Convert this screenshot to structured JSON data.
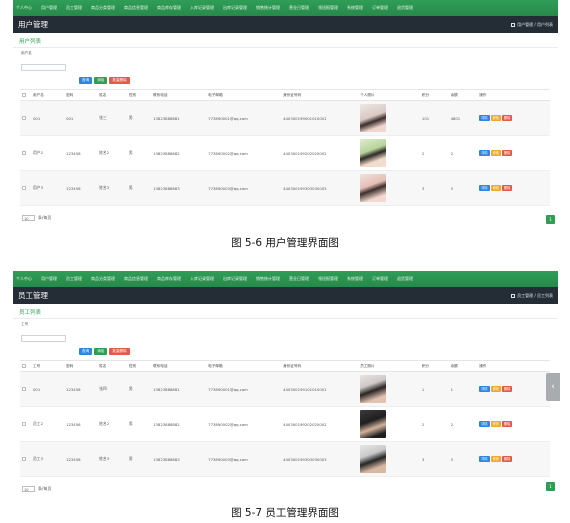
{
  "nav": [
    "个人中心",
    "用户管理",
    "员工管理",
    "商品分类管理",
    "商品信息管理",
    "商品库存管理",
    "入库记录管理",
    "出库记录管理",
    "销售统计管理",
    "营业日管理",
    "领班报管理",
    "系统管理",
    "订单管理",
    "退货管理"
  ],
  "panels": [
    {
      "page_title": "用户管理",
      "breadcrumb": "用户管理 / 用户列表",
      "section_title": "用户列表",
      "filter_label": "用户名",
      "buttons": {
        "search": "查询",
        "add": "添加",
        "batch_delete": "批量删除"
      },
      "columns": [
        "",
        "用户名",
        "密码",
        "姓名",
        "性别",
        "联系电话",
        "电子邮箱",
        "身份证号码",
        "个人照片",
        "积分",
        "余额",
        "操作"
      ],
      "rows": [
        {
          "cells": [
            "001",
            "001",
            "张三",
            "男",
            "13823888881",
            "773890001@qq.com",
            "440300199001010001",
            "",
            "101",
            "4801"
          ],
          "avatar": "av-1"
        },
        {
          "cells": [
            "用户2",
            "123456",
            "姓名2",
            "男",
            "13823888882",
            "773890002@qq.com",
            "440300199202020002",
            "",
            "2",
            "2"
          ],
          "avatar": "av-2"
        },
        {
          "cells": [
            "用户3",
            "123456",
            "姓名3",
            "男",
            "13823888883",
            "773890003@qq.com",
            "440300199303030003",
            "",
            "3",
            "3"
          ],
          "avatar": "av-3"
        }
      ],
      "row_actions": {
        "detail": "详情",
        "edit": "修改",
        "delete": "删除"
      },
      "page_size": "10",
      "page_size_suffix": "条/每页",
      "page_number": "1",
      "caption": "图 5-6 用户管理界面图"
    },
    {
      "page_title": "员工管理",
      "breadcrumb": "员工管理 / 员工列表",
      "section_title": "员工列表",
      "filter_label": "工号",
      "buttons": {
        "search": "查询",
        "add": "添加",
        "batch_delete": "批量删除"
      },
      "columns": [
        "",
        "工号",
        "密码",
        "姓名",
        "性别",
        "联系电话",
        "电子邮箱",
        "身份证号码",
        "员工照片",
        "积分",
        "余额",
        "操作"
      ],
      "rows": [
        {
          "cells": [
            "001",
            "123456",
            "张四",
            "男",
            "13823888881",
            "773890001@qq.com",
            "440300199101010001",
            "",
            "1",
            "1"
          ],
          "avatar": "av-4"
        },
        {
          "cells": [
            "员工2",
            "123456",
            "姓名2",
            "男",
            "13823888882",
            "773890002@qq.com",
            "440300199202020002",
            "",
            "2",
            "2"
          ],
          "avatar": "av-5"
        },
        {
          "cells": [
            "员工3",
            "123456",
            "姓名3",
            "男",
            "13823888883",
            "773890003@qq.com",
            "440300199303030003",
            "",
            "3",
            "3"
          ],
          "avatar": "av-6"
        }
      ],
      "row_actions": {
        "detail": "详情",
        "edit": "修改",
        "delete": "删除"
      },
      "page_size": "10",
      "page_size_suffix": "条/每页",
      "page_number": "1",
      "caption": "图 5-7 员工管理界面图"
    }
  ],
  "colors": {
    "nav_green": "#2e9e55",
    "titlebar": "#242d35",
    "btn_blue": "#2e86de",
    "btn_red": "#e25a4a",
    "btn_yellow": "#f0a82a"
  },
  "icons": [
    "home-icon",
    "chevron-left-icon"
  ]
}
